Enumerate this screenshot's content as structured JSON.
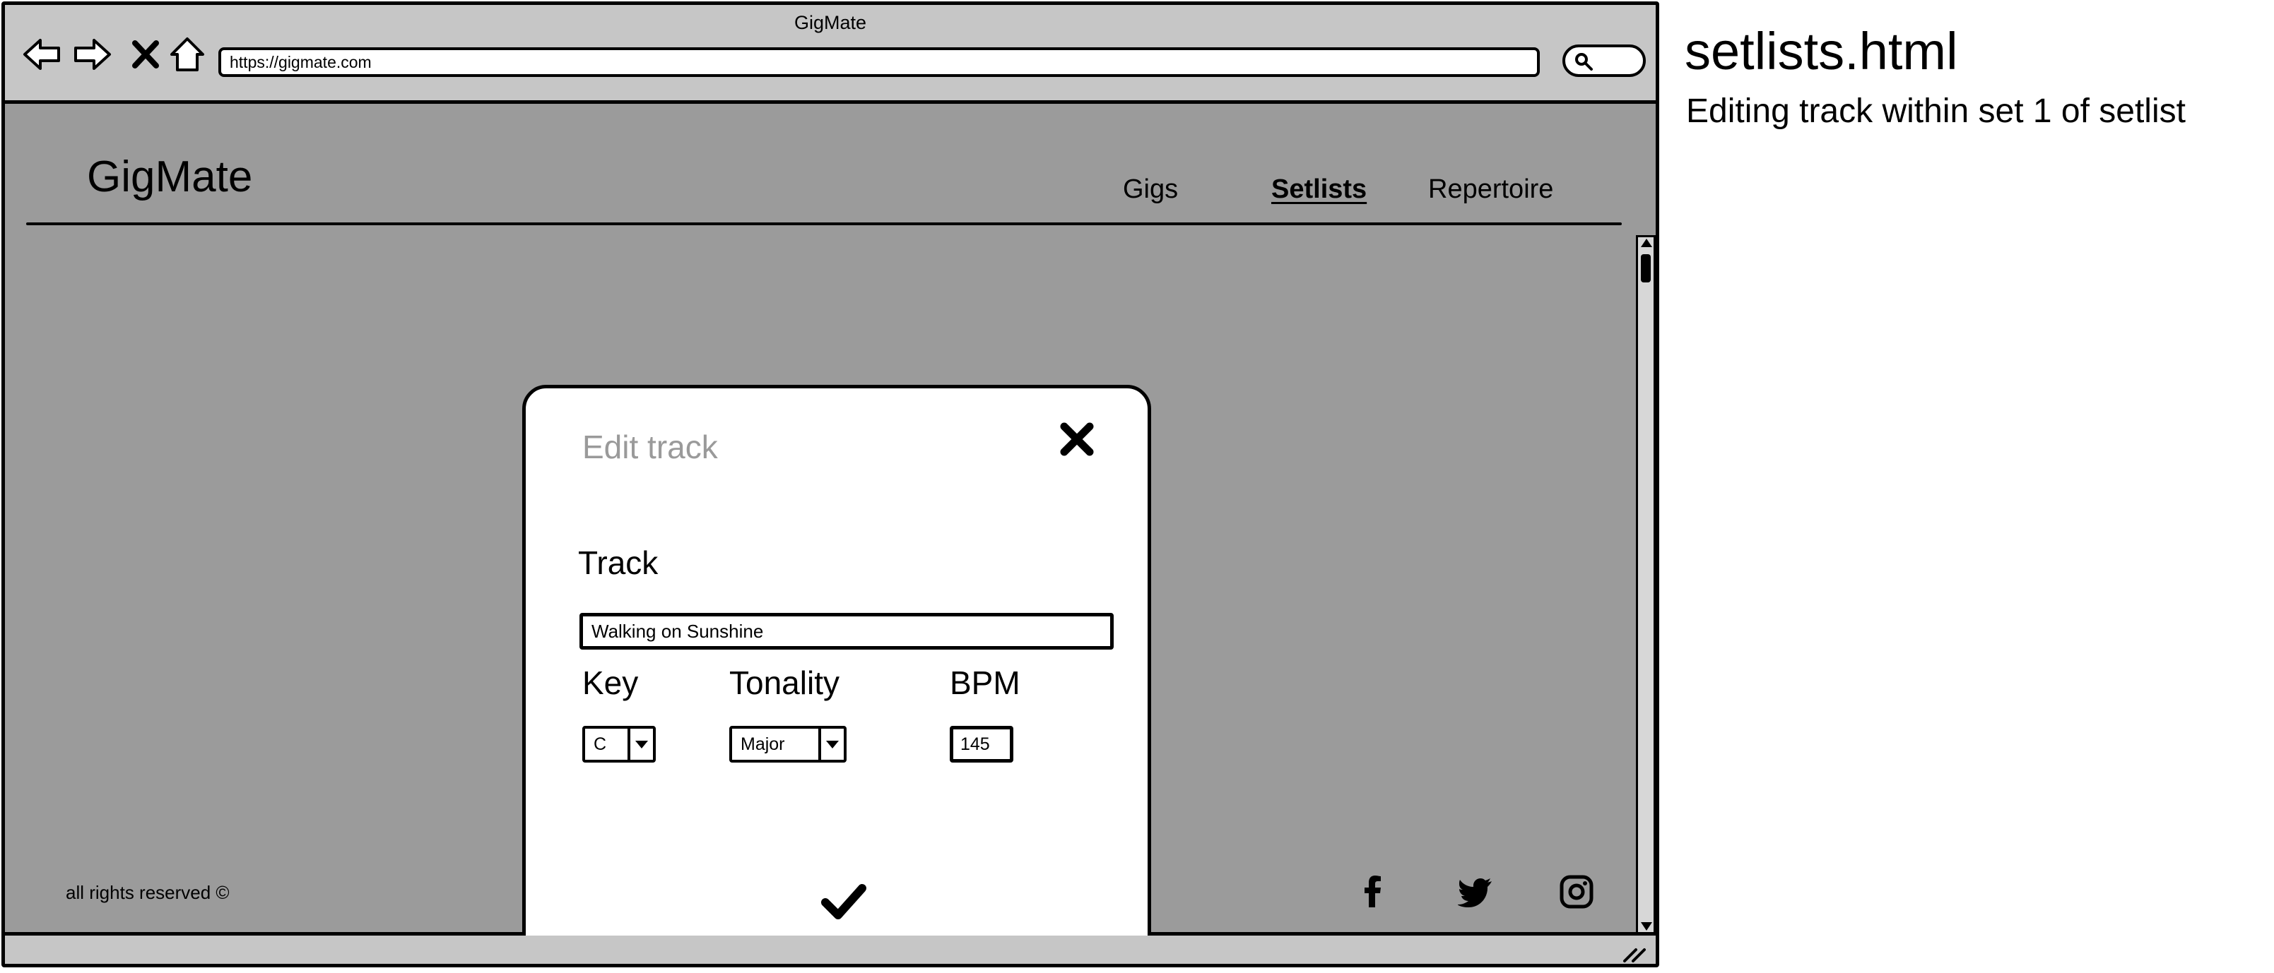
{
  "window": {
    "title": "GigMate",
    "url": "https://gigmate.com"
  },
  "header": {
    "brand": "GigMate",
    "nav": [
      {
        "label": "Gigs",
        "active": false
      },
      {
        "label": "Setlists",
        "active": true
      },
      {
        "label": "Repertoire",
        "active": false
      }
    ]
  },
  "modal": {
    "title": "Edit track",
    "track_label": "Track",
    "track_value": "Walking on Sunshine",
    "key_label": "Key",
    "key_value": "C",
    "tonality_label": "Tonality",
    "tonality_value": "Major",
    "bpm_label": "BPM",
    "bpm_value": "145"
  },
  "footer": {
    "copyright": "all rights reserved ©",
    "social": [
      "facebook-icon",
      "twitter-icon",
      "instagram-icon"
    ]
  },
  "annotation": {
    "page_name": "setlists.html",
    "description": "Editing track within set 1 of setlist"
  },
  "colors": {
    "page_background": "#9b9b9b",
    "chrome": "#c6c6c6",
    "modal_title": "#9a9a9a"
  }
}
